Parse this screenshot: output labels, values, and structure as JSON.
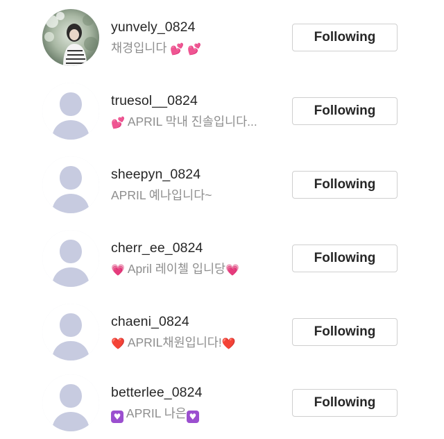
{
  "following_list": {
    "items": [
      {
        "username": "yunvely_0824",
        "bio_text": "채경입니다",
        "bio_emoji_after": "💕 💕",
        "button_label": "Following",
        "avatar": "photo"
      },
      {
        "username": "truesol__0824",
        "bio_emoji_before": "💕",
        "bio_text": "APRIL 막내 진솔입니다...",
        "button_label": "Following",
        "avatar": "default-person-icon"
      },
      {
        "username": "sheepyn_0824",
        "bio_text": "APRIL 예나입니다~",
        "button_label": "Following",
        "avatar": "default-person-icon"
      },
      {
        "username": "cherr_ee_0824",
        "bio_emoji_before": "💗",
        "bio_text": "April 레이첼 입니당",
        "bio_emoji_after": "💗",
        "button_label": "Following",
        "avatar": "default-person-icon"
      },
      {
        "username": "chaeni_0824",
        "bio_emoji_before": "❤️",
        "bio_text": "APRIL채원입니다!",
        "bio_emoji_after": "❤️",
        "button_label": "Following",
        "avatar": "default-person-icon"
      },
      {
        "username": "betterlee_0824",
        "bio_emoji_before": "💟",
        "bio_text": "APRIL 나은",
        "bio_emoji_after": "💟",
        "button_label": "Following",
        "avatar": "default-person-icon"
      }
    ]
  },
  "colors": {
    "username": "#262626",
    "bio": "#8e8e8e",
    "button_border": "#cfcfcf",
    "avatar_silhouette": "#c7cbe0"
  }
}
